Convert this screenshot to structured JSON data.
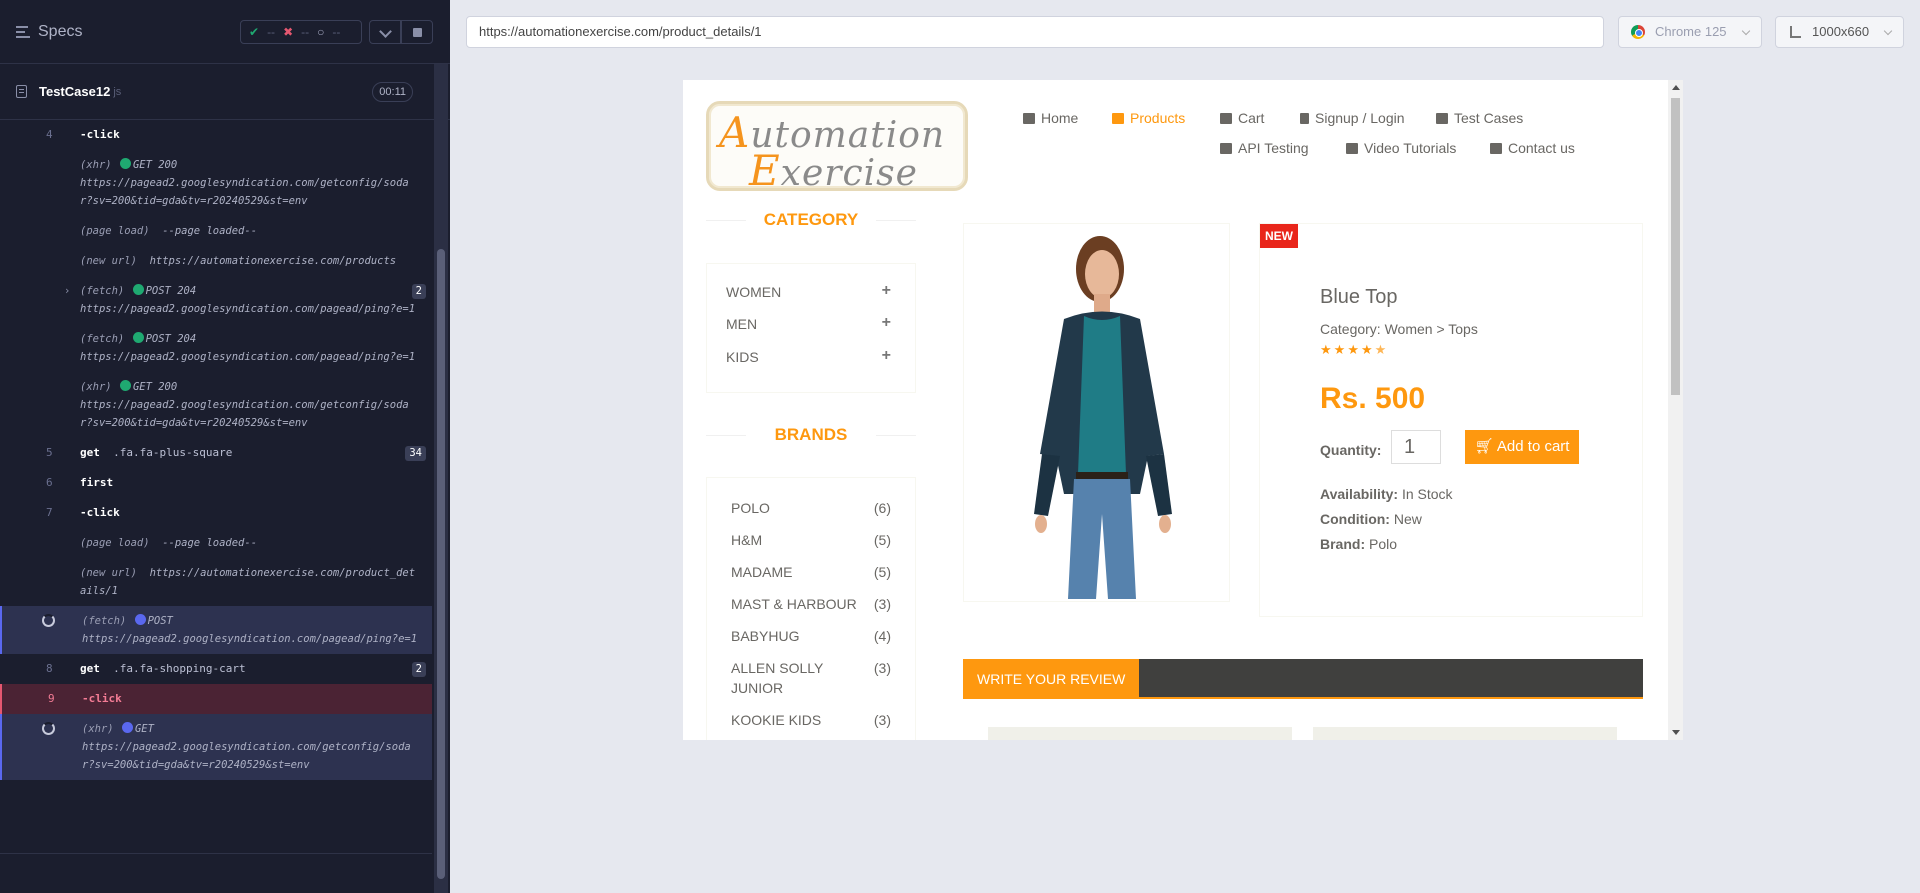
{
  "runner": {
    "header_title": "Specs",
    "stats": {
      "passed": "--",
      "failed": "--",
      "pending": "--"
    },
    "spec": {
      "name": "TestCase12",
      "ext": "js",
      "timer": "00:11"
    },
    "log": [
      {
        "num": "4",
        "name": "-click"
      },
      {
        "type": "(xhr)",
        "status": "GET 200",
        "url": "https://pagead2.googlesyndication.com/getconfig/sodar?sv=200&tid=gda&tv=r20240529&st=env"
      },
      {
        "type": "(page load)",
        "text": "--page loaded--"
      },
      {
        "type": "(new url)",
        "url": "https://automationexercise.com/products"
      },
      {
        "type": "(fetch)",
        "status": "POST 204",
        "url": "https://pagead2.googlesyndication.com/pagead/ping?e=1",
        "count": "2"
      },
      {
        "type": "(fetch)",
        "status": "POST 204",
        "url": "https://pagead2.googlesyndication.com/pagead/ping?e=1"
      },
      {
        "type": "(xhr)",
        "status": "GET 200",
        "url": "https://pagead2.googlesyndication.com/getconfig/sodar?sv=200&tid=gda&tv=r20240529&st=env"
      },
      {
        "num": "5",
        "name": "get",
        "arg": ".fa.fa-plus-square",
        "count": "34"
      },
      {
        "num": "6",
        "name": "first"
      },
      {
        "num": "7",
        "name": "-click"
      },
      {
        "type": "(page load)",
        "text": "--page loaded--"
      },
      {
        "type": "(new url)",
        "url": "https://automationexercise.com/product_details/1"
      },
      {
        "type": "(fetch)",
        "status": "POST",
        "url": "https://pagead2.googlesyndication.com/pagead/ping?e=1"
      },
      {
        "num": "8",
        "name": "get",
        "arg": ".fa.fa-shopping-cart",
        "count": "2"
      },
      {
        "num": "9",
        "name": "-click"
      },
      {
        "type": "(xhr)",
        "status": "GET",
        "url": "https://pagead2.googlesyndication.com/getconfig/sodar?sv=200&tid=gda&tv=r20240529&st=env"
      }
    ]
  },
  "browser": {
    "url": "https://automationexercise.com/product_details/1",
    "browser_name": "Chrome 125",
    "viewport": "1000x660"
  },
  "site": {
    "logo": {
      "a": "A",
      "l1_rest": "utomation",
      "e": "E",
      "l2_rest": "xercise"
    },
    "nav": {
      "home": "Home",
      "products": "Products",
      "cart": "Cart",
      "signup": "Signup / Login",
      "test_cases": "Test Cases",
      "api": "API Testing",
      "video": "Video Tutorials",
      "contact": "Contact us"
    },
    "category_title": "CATEGORY",
    "categories": [
      "WOMEN",
      "MEN",
      "KIDS"
    ],
    "brands_title": "BRANDS",
    "brands": [
      {
        "name": "POLO",
        "count": "(6)"
      },
      {
        "name": "H&M",
        "count": "(5)"
      },
      {
        "name": "MADAME",
        "count": "(5)"
      },
      {
        "name": "MAST & HARBOUR",
        "count": "(3)"
      },
      {
        "name": "BABYHUG",
        "count": "(4)"
      },
      {
        "name": "ALLEN SOLLY JUNIOR",
        "count": "(3)"
      },
      {
        "name": "KOOKIE KIDS",
        "count": "(3)"
      }
    ],
    "product": {
      "badge": "NEW",
      "name": "Blue Top",
      "category": "Category: Women > Tops",
      "rating": 4.5,
      "price": "Rs. 500",
      "quantity_label": "Quantity:",
      "quantity": "1",
      "add_to_cart": "Add to cart",
      "availability_label": "Availability:",
      "availability": "In Stock",
      "condition_label": "Condition:",
      "condition": "New",
      "brand_label": "Brand:",
      "brand": "Polo"
    },
    "review_tab": "WRITE YOUR REVIEW"
  },
  "colors": {
    "accent": "#fe980f",
    "runner_bg": "#1b1e2e",
    "passed": "#1fa971",
    "failed": "#e45770",
    "pending": "#5a68ef"
  }
}
